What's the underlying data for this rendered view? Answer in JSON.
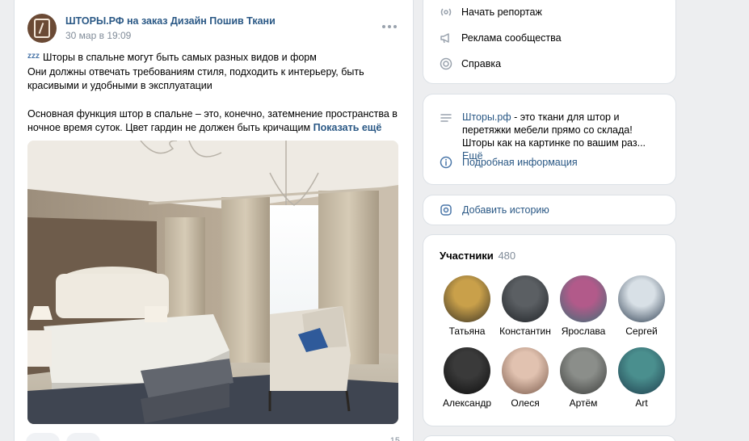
{
  "post": {
    "author": "ШТОРЫ.РФ на заказ Дизайн Пошив Ткани",
    "date": "30 мар в 19:09",
    "zzz": "zzz",
    "line1": "Шторы в спальне могут быть самых разных видов и форм",
    "line2": "Они должны отвечать требованиям стиля, подходить к интерьеру, быть красивыми и удобными в эксплуатации",
    "line3": "Основная функция штор в спальне – это, конечно, затемнение пространства в ночное время суток. Цвет гардин не должен быть кричащим",
    "show_more": "Показать ещё",
    "views": "15"
  },
  "menu": {
    "items": [
      {
        "label": "Начать репортаж",
        "icon": "broadcast-icon"
      },
      {
        "label": "Реклама сообщества",
        "icon": "megaphone-icon"
      },
      {
        "label": "Справка",
        "icon": "help-lifebuoy-icon"
      }
    ]
  },
  "info": {
    "site_link": "Шторы.рф",
    "description": " - это ткани для штор и перетяжки мебели прямо со склада! Шторы как на картинке по вашим раз... ",
    "more": "Ещё",
    "details": "Подробная информация"
  },
  "story": {
    "label": "Добавить историю"
  },
  "members": {
    "title": "Участники",
    "count": "480",
    "list": [
      {
        "name": "Татьяна",
        "colors": [
          "#c9a04a",
          "#3a3324"
        ]
      },
      {
        "name": "Константин",
        "colors": [
          "#5b5f63",
          "#1f2226"
        ]
      },
      {
        "name": "Ярослава",
        "colors": [
          "#b25a8a",
          "#3c6f77"
        ]
      },
      {
        "name": "Сергей",
        "colors": [
          "#d8e0e6",
          "#2f3f52"
        ]
      },
      {
        "name": "Александр",
        "colors": [
          "#3a3a3a",
          "#0d0d0d"
        ]
      },
      {
        "name": "Олеся",
        "colors": [
          "#e1c2b0",
          "#7a5a4b"
        ]
      },
      {
        "name": "Артём",
        "colors": [
          "#8b8e8a",
          "#3b3c3a"
        ]
      },
      {
        "name": "Art",
        "colors": [
          "#4a8f8e",
          "#1e3d4d"
        ]
      }
    ]
  }
}
